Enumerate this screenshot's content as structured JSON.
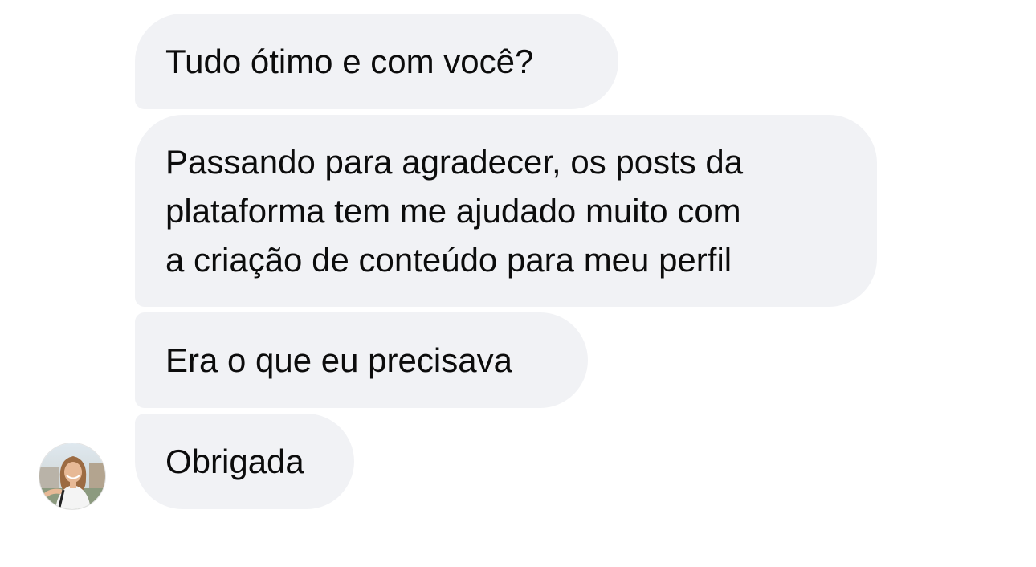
{
  "messages": [
    {
      "text": "Tudo ótimo e com você?"
    },
    {
      "text": "Passando para agradecer, os posts da\nplataforma tem me ajudado muito com\na criação de conteúdo para meu perfil"
    },
    {
      "text": "Era o que eu precisava"
    },
    {
      "text": "Obrigada"
    }
  ],
  "avatar": {
    "icon": "user-avatar-photo"
  },
  "colors": {
    "bubble_bg": "#f1f2f5",
    "text": "#0c0c0c",
    "background": "#ffffff"
  }
}
